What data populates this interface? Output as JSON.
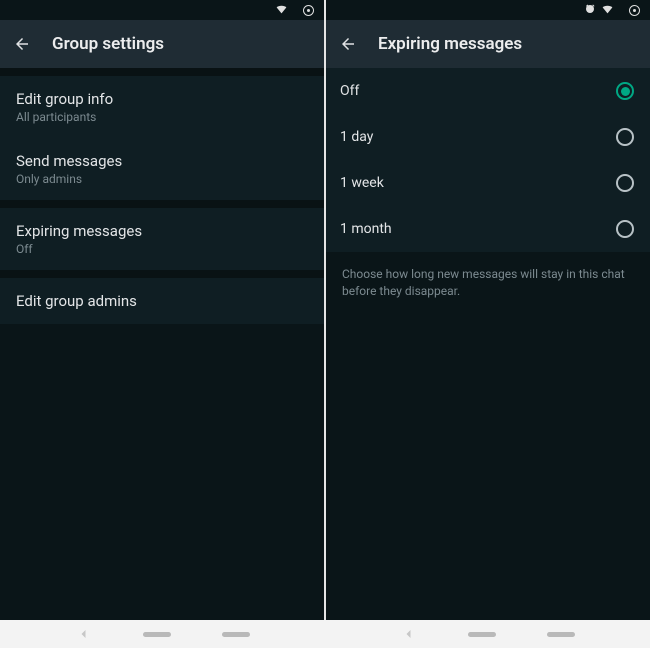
{
  "left": {
    "title": "Group settings",
    "items": [
      {
        "primary": "Edit group info",
        "secondary": "All participants"
      },
      {
        "primary": "Send messages",
        "secondary": "Only admins"
      },
      {
        "primary": "Expiring messages",
        "secondary": "Off"
      },
      {
        "primary": "Edit group admins",
        "secondary": ""
      }
    ]
  },
  "right": {
    "title": "Expiring messages",
    "options": [
      {
        "label": "Off",
        "selected": true
      },
      {
        "label": "1 day",
        "selected": false
      },
      {
        "label": "1 week",
        "selected": false
      },
      {
        "label": "1 month",
        "selected": false
      }
    ],
    "help": "Choose how long new messages will stay in this chat before they disappear."
  }
}
